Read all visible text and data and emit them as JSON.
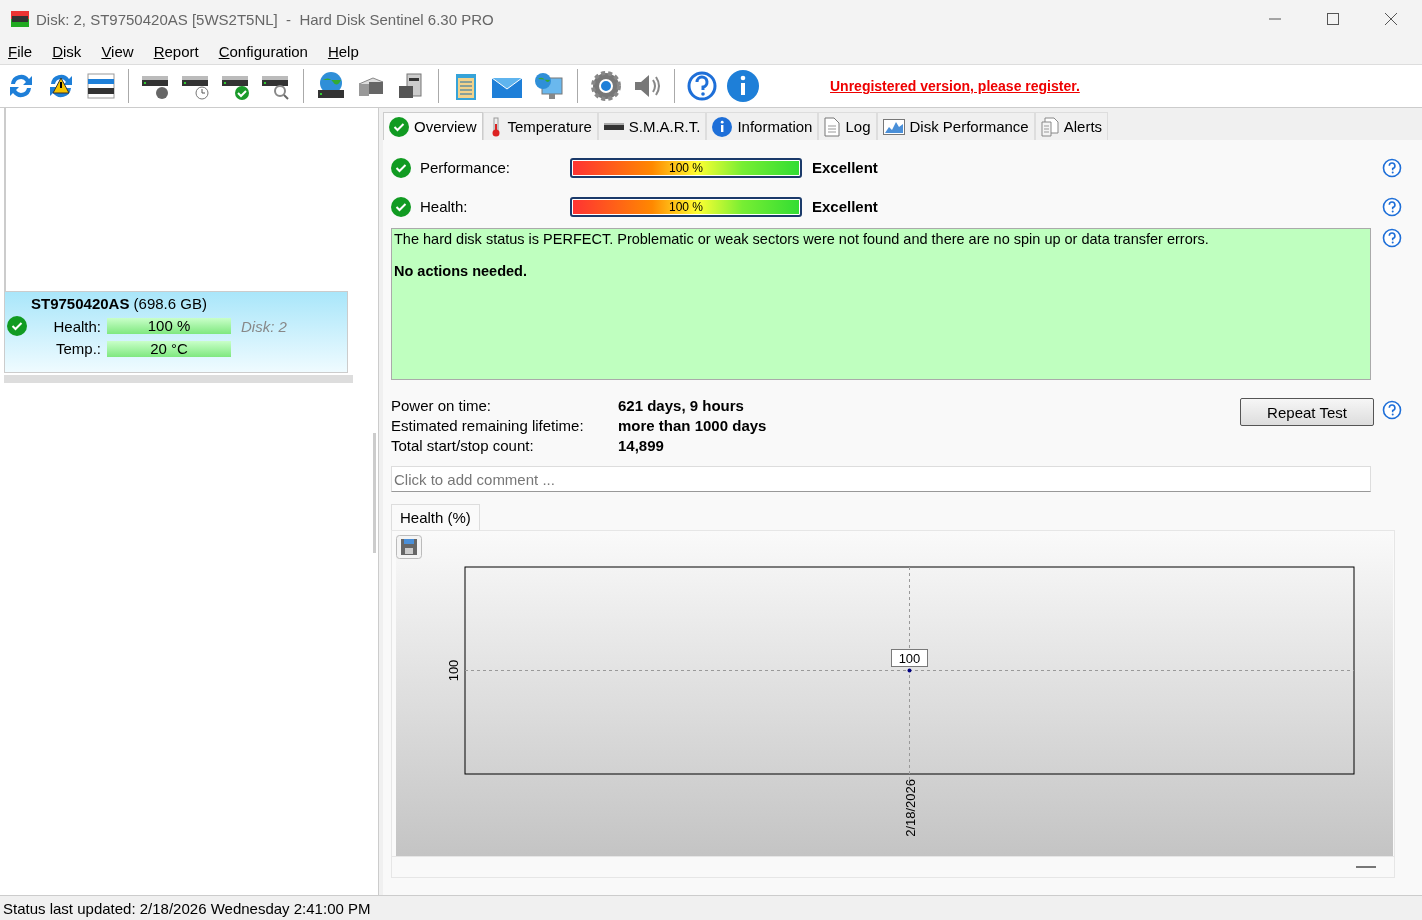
{
  "window": {
    "title": "Disk: 2, ST9750420AS [5WS2T5NL]  -  Hard Disk Sentinel 6.30 PRO"
  },
  "menu": [
    {
      "label": "File"
    },
    {
      "label": "Disk"
    },
    {
      "label": "View"
    },
    {
      "label": "Report"
    },
    {
      "label": "Configuration"
    },
    {
      "label": "Help"
    }
  ],
  "register_link": "Unregistered version, please register.",
  "disk": {
    "model": "ST9750420AS",
    "size": "(698.6 GB)",
    "selected": true,
    "health_label": "Health:",
    "health": "100 %",
    "health_meter": {
      "level": 1
    },
    "temp_label": "Temp.:",
    "temp": "20 °C",
    "disk_no": "Disk: 2"
  },
  "tabs": [
    {
      "label": "Overview",
      "selected": true
    },
    {
      "label": "Temperature",
      "selected": false
    },
    {
      "label": "S.M.A.R.T.",
      "selected": false
    },
    {
      "label": "Information",
      "selected": false
    },
    {
      "label": "Log",
      "selected": false
    },
    {
      "label": "Disk Performance",
      "selected": false
    },
    {
      "label": "Alerts",
      "selected": false
    }
  ],
  "meters": [
    {
      "label": "Performance:",
      "level": 1,
      "reading": "100 %",
      "rating": "Excellent"
    },
    {
      "label": "Health:",
      "level": 1,
      "reading": "100 %",
      "rating": "Excellent"
    }
  ],
  "status_text": "The hard disk status is PERFECT. Problematic or weak sectors were not found and there are no spin up or data transfer errors.",
  "status_action": "No actions needed.",
  "facts": [
    {
      "label": "Power on time:",
      "value": "621 days, 9 hours"
    },
    {
      "label": "Estimated remaining lifetime:",
      "value": "more than 1000 days"
    },
    {
      "label": "Total start/stop count:",
      "value": "14,899"
    }
  ],
  "repeat_button": "Repeat Test",
  "comment": {
    "placeholder": "Click to add comment ..."
  },
  "chart": {
    "tab": "Health (%)",
    "y_tick_label": "100",
    "x_tick_label": "2/18/2026",
    "point_label": "100"
  },
  "status_bar": "Status last updated: 2/18/2026 Wednesday 2:41:00 PM"
}
